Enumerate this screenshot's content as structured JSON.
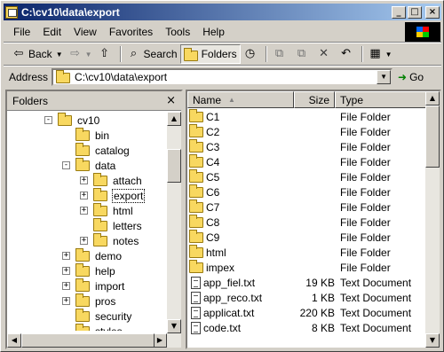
{
  "window": {
    "title": "C:\\cv10\\data\\export"
  },
  "title_buttons": {
    "minimize": "_",
    "maximize": "□",
    "close": "×"
  },
  "menu": [
    {
      "label": "File"
    },
    {
      "label": "Edit"
    },
    {
      "label": "View"
    },
    {
      "label": "Favorites"
    },
    {
      "label": "Tools"
    },
    {
      "label": "Help"
    }
  ],
  "toolbar": {
    "back_label": "Back",
    "search_label": "Search",
    "folders_label": "Folders",
    "icons": [
      "back-arrow-icon",
      "forward-arrow-icon",
      "up-folder-icon",
      "search-icon",
      "folders-icon",
      "history-icon",
      "move-to-icon",
      "copy-to-icon",
      "delete-icon",
      "undo-icon",
      "views-icon"
    ]
  },
  "address": {
    "label": "Address",
    "value": "C:\\cv10\\data\\export",
    "go_label": "Go"
  },
  "folders_pane": {
    "title": "Folders",
    "close": "×",
    "tree": [
      {
        "label": "cv10",
        "level": 0,
        "expander": "-"
      },
      {
        "label": "bin",
        "level": 1,
        "expander": ""
      },
      {
        "label": "catalog",
        "level": 1,
        "expander": ""
      },
      {
        "label": "data",
        "level": 1,
        "expander": "-"
      },
      {
        "label": "attach",
        "level": 2,
        "expander": "+"
      },
      {
        "label": "export",
        "level": 2,
        "expander": "+",
        "selected": true
      },
      {
        "label": "html",
        "level": 2,
        "expander": "+"
      },
      {
        "label": "letters",
        "level": 2,
        "expander": ""
      },
      {
        "label": "notes",
        "level": 2,
        "expander": "+"
      },
      {
        "label": "demo",
        "level": 1,
        "expander": "+"
      },
      {
        "label": "help",
        "level": 1,
        "expander": "+"
      },
      {
        "label": "import",
        "level": 1,
        "expander": "+"
      },
      {
        "label": "pros",
        "level": 1,
        "expander": "+"
      },
      {
        "label": "security",
        "level": 1,
        "expander": ""
      },
      {
        "label": "styles",
        "level": 1,
        "expander": ""
      }
    ]
  },
  "file_list": {
    "columns": {
      "name": "Name",
      "size": "Size",
      "type": "Type"
    },
    "sort_indicator": "▲",
    "rows": [
      {
        "name": "C1",
        "size": "",
        "type": "File Folder",
        "kind": "folder"
      },
      {
        "name": "C2",
        "size": "",
        "type": "File Folder",
        "kind": "folder"
      },
      {
        "name": "C3",
        "size": "",
        "type": "File Folder",
        "kind": "folder"
      },
      {
        "name": "C4",
        "size": "",
        "type": "File Folder",
        "kind": "folder"
      },
      {
        "name": "C5",
        "size": "",
        "type": "File Folder",
        "kind": "folder"
      },
      {
        "name": "C6",
        "size": "",
        "type": "File Folder",
        "kind": "folder"
      },
      {
        "name": "C7",
        "size": "",
        "type": "File Folder",
        "kind": "folder"
      },
      {
        "name": "C8",
        "size": "",
        "type": "File Folder",
        "kind": "folder"
      },
      {
        "name": "C9",
        "size": "",
        "type": "File Folder",
        "kind": "folder"
      },
      {
        "name": "html",
        "size": "",
        "type": "File Folder",
        "kind": "folder"
      },
      {
        "name": "impex",
        "size": "",
        "type": "File Folder",
        "kind": "folder"
      },
      {
        "name": "app_fiel.txt",
        "size": "19 KB",
        "type": "Text Document",
        "kind": "file"
      },
      {
        "name": "app_reco.txt",
        "size": "1 KB",
        "type": "Text Document",
        "kind": "file"
      },
      {
        "name": "applicat.txt",
        "size": "220 KB",
        "type": "Text Document",
        "kind": "file"
      },
      {
        "name": "code.txt",
        "size": "8 KB",
        "type": "Text Document",
        "kind": "file"
      }
    ]
  }
}
